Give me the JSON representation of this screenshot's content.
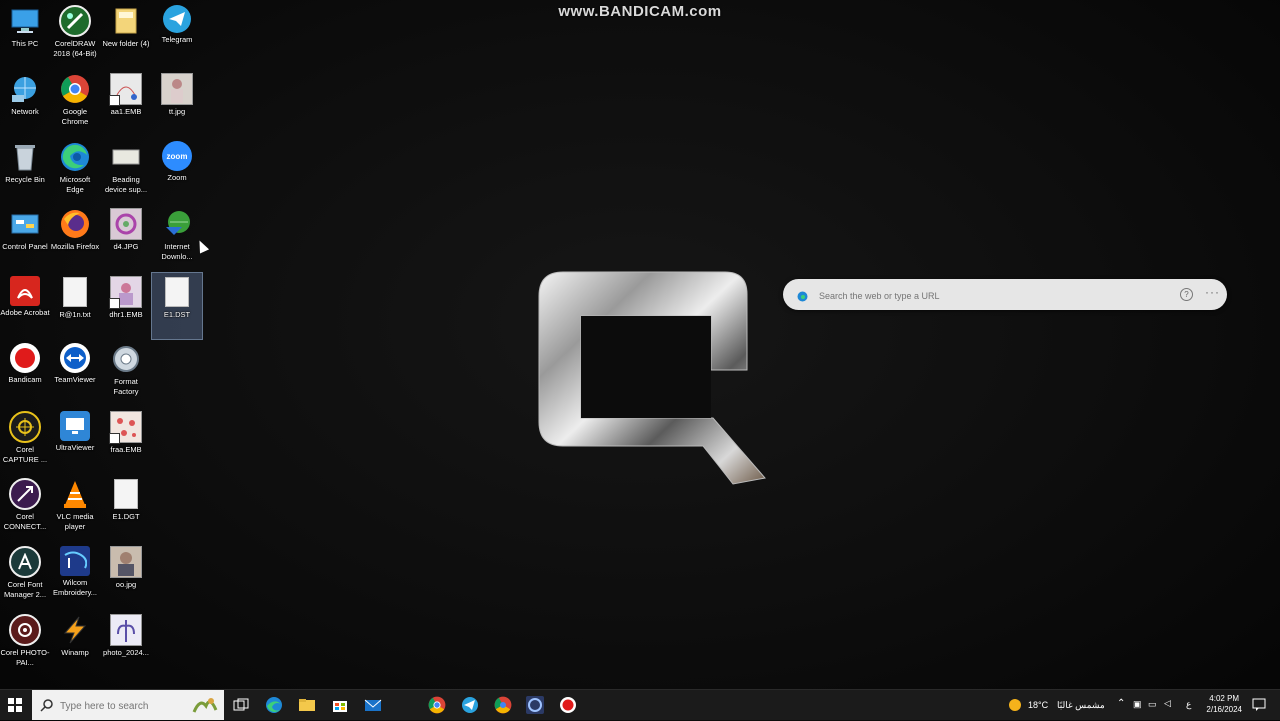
{
  "watermark": "www.BANDICAM.com",
  "desktop_icons": [
    {
      "label": "This PC"
    },
    {
      "label": "CorelDRAW 2018 (64-Bit)"
    },
    {
      "label": "New folder (4)"
    },
    {
      "label": "Telegram"
    },
    {
      "label": "Network"
    },
    {
      "label": "Google Chrome"
    },
    {
      "label": "aa1.EMB"
    },
    {
      "label": "tt.jpg"
    },
    {
      "label": "Recycle Bin"
    },
    {
      "label": "Microsoft Edge"
    },
    {
      "label": "Beading device sup..."
    },
    {
      "label": "Zoom"
    },
    {
      "label": "Control Panel"
    },
    {
      "label": "Mozilla Firefox"
    },
    {
      "label": "d4.JPG"
    },
    {
      "label": "Internet Downlo..."
    },
    {
      "label": "Adobe Acrobat"
    },
    {
      "label": "R@1n.txt"
    },
    {
      "label": "dhr1.EMB"
    },
    {
      "label": "E1.DST"
    },
    {
      "label": "Bandicam"
    },
    {
      "label": "TeamViewer"
    },
    {
      "label": "Format Factory"
    },
    {
      "label": "Corel CAPTURE ..."
    },
    {
      "label": "UltraViewer"
    },
    {
      "label": "fraa.EMB"
    },
    {
      "label": "Corel CONNECT..."
    },
    {
      "label": "VLC media player"
    },
    {
      "label": "E1.DGT"
    },
    {
      "label": "Corel Font Manager 2..."
    },
    {
      "label": "Wilcom Embroidery..."
    },
    {
      "label": "oo.jpg"
    },
    {
      "label": "Corel PHOTO-PAI..."
    },
    {
      "label": "Winamp"
    },
    {
      "label": "photo_2024..."
    }
  ],
  "zoom_icon_text": "zoom",
  "new_tab_search": {
    "placeholder": "Search the web or type a URL",
    "help_glyph": "?",
    "more_glyph": "···"
  },
  "taskbar": {
    "search_placeholder": "Type here to search",
    "weather": "18°C",
    "weather_desc": "مشمس غالبًا",
    "lang": "ع",
    "time": "4:02 PM",
    "date": "2/16/2024"
  },
  "colors": {
    "accent": "#0078d4",
    "chrome_red": "#db4437",
    "chrome_green": "#0f9d58",
    "chrome_yellow": "#f4b400"
  }
}
